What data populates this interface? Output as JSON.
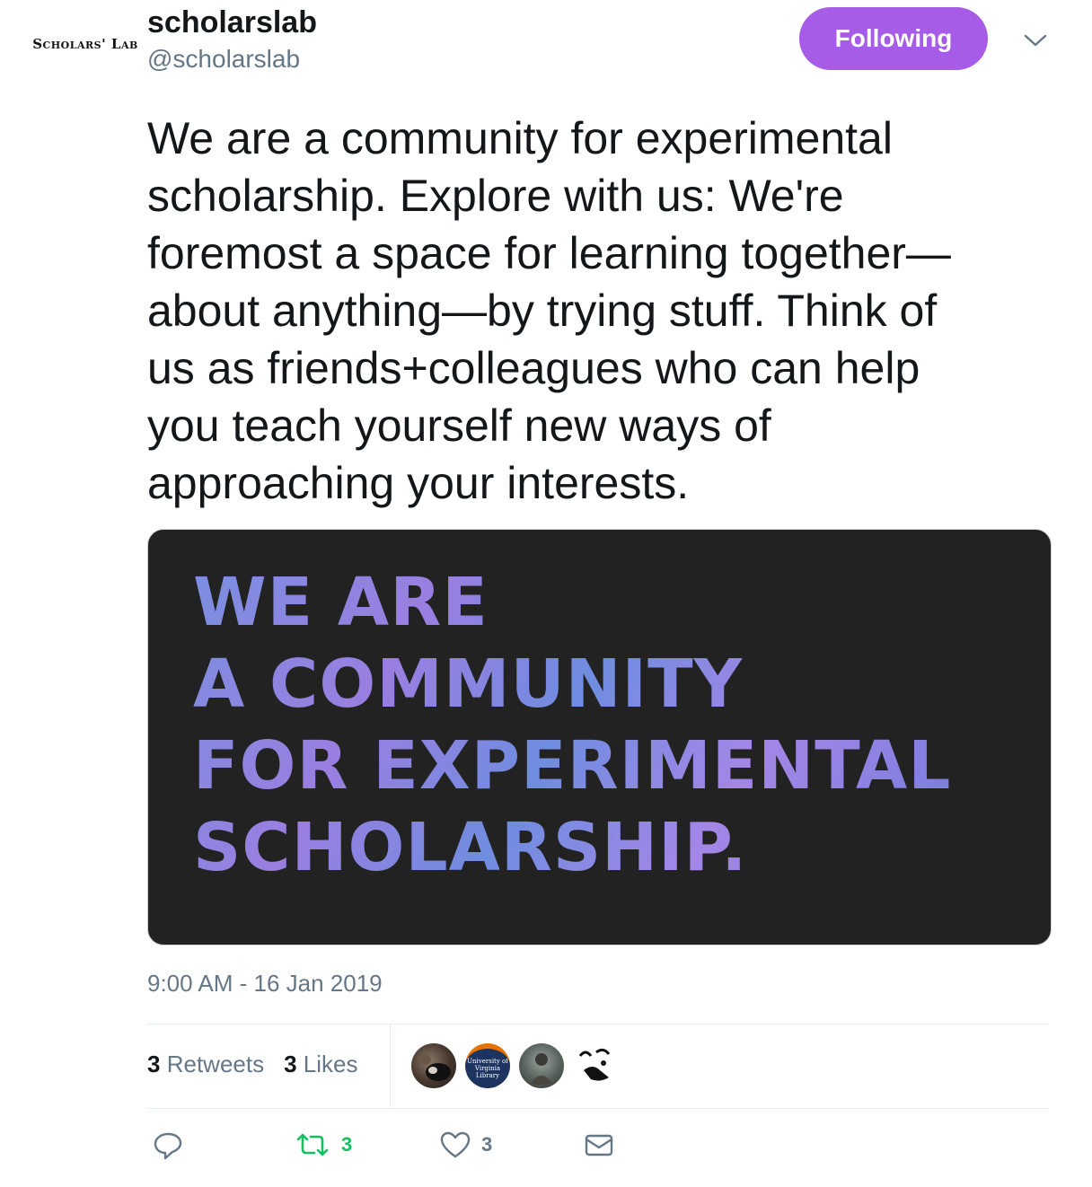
{
  "account": {
    "avatar_text": "Scholars' Lab",
    "display_name": "scholarslab",
    "handle": "@scholarslab",
    "follow_label": "Following"
  },
  "tweet": {
    "text": "We are a community for experimental\nscholarship. Explore with us: We're\nforemost a space for learning together—\nabout anything—by trying stuff. Think of\nus as friends+colleagues who can help\nyou teach yourself new ways of\napproaching your interests.",
    "media_text": "WE ARE\nA COMMUNITY\nFOR EXPERIMENTAL\nSCHOLARSHIP.",
    "timestamp": "9:00 AM - 16 Jan 2019"
  },
  "stats": {
    "retweets_count": "3",
    "retweets_label": "Retweets",
    "likes_count": "3",
    "likes_label": "Likes"
  },
  "likers": [
    {
      "icon": "dog-photo-avatar"
    },
    {
      "icon": "uva-library-avatar",
      "text": "University of Virginia Library"
    },
    {
      "icon": "person-photo-avatar"
    },
    {
      "icon": "line-drawing-avatar"
    }
  ],
  "actions": {
    "reply_icon": "reply-icon",
    "retweet_count": "3",
    "like_count": "3",
    "dm_icon": "envelope-icon"
  },
  "colors": {
    "follow_button": "#a65ce6",
    "retweet_green": "#17bf63",
    "secondary_text": "#657786",
    "media_background": "#222222"
  }
}
